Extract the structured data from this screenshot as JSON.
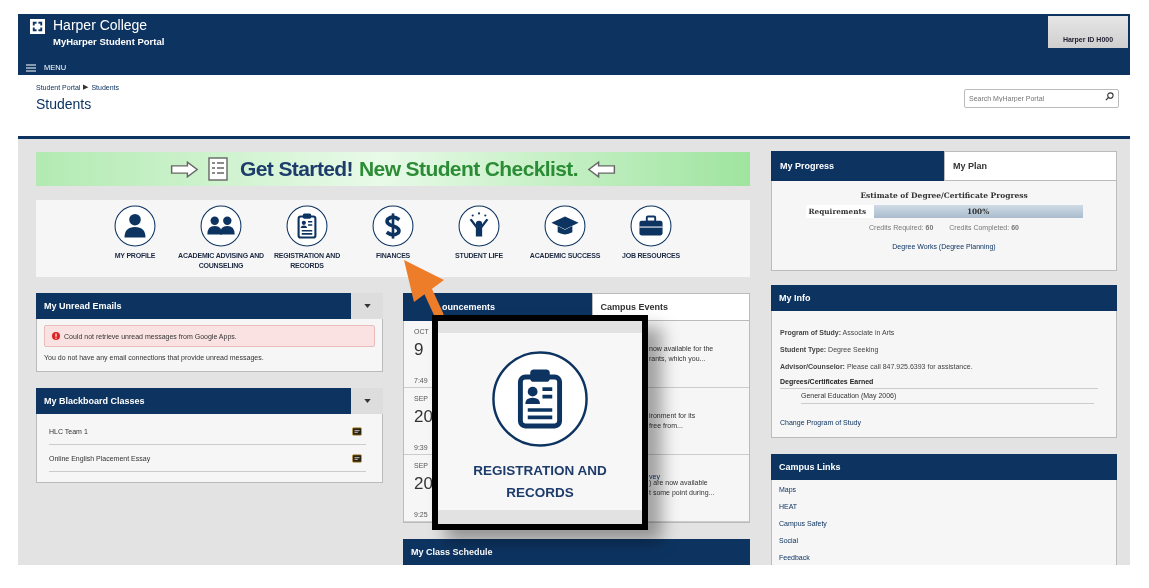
{
  "header": {
    "college": "Harper College",
    "portal": "MyHarper Student Portal",
    "menu": "MENU",
    "user_id": "Harper ID H000"
  },
  "breadcrumb": {
    "items": [
      "Student Portal",
      "Students"
    ],
    "separator": "▶"
  },
  "page_title": "Students",
  "search": {
    "placeholder": "Search MyHarper Portal"
  },
  "banner": {
    "lead": "Get Started!",
    "rest": "New Student Checklist."
  },
  "quick_links": [
    {
      "label": "MY PROFILE",
      "kind": "person"
    },
    {
      "label": "ACADEMIC ADVISING AND COUNSELING",
      "kind": "people"
    },
    {
      "label": "REGISTRATION AND RECORDS",
      "kind": "clipboard"
    },
    {
      "label": "FINANCES",
      "kind": "dollar"
    },
    {
      "label": "STUDENT LIFE",
      "kind": "cheer"
    },
    {
      "label": "ACADEMIC SUCCESS",
      "kind": "cap"
    },
    {
      "label": "JOB RESOURCES",
      "kind": "briefcase"
    }
  ],
  "emails": {
    "title": "My Unread Emails",
    "alert": "Could not retrieve unread messages from Google Apps.",
    "message": "You do not have any email connections that provide unread messages."
  },
  "blackboard": {
    "title": "My Blackboard Classes",
    "classes": [
      "HLC Team 1",
      "Online English Placement Essay"
    ]
  },
  "news": {
    "tabs": [
      {
        "label": "ouncements",
        "selected": true
      },
      {
        "label": "Campus Events",
        "selected": false
      }
    ],
    "items": [
      {
        "month": "OCT",
        "day": "9",
        "time": "7:49",
        "lines": [
          "now available for the",
          "rants, which you..."
        ]
      },
      {
        "month": "SEP",
        "day": "20",
        "time": "9:39",
        "lines": [
          "ironment for its",
          "free from..."
        ]
      },
      {
        "month": "SEP",
        "day": "20",
        "time": "9:25",
        "title": "vey",
        "lines": [
          ") are now available",
          "t some point during..."
        ]
      }
    ]
  },
  "class_schedule": {
    "title": "My Class Schedule"
  },
  "progress": {
    "tabs": [
      {
        "label": "My Progress",
        "selected": true
      },
      {
        "label": "My Plan",
        "selected": false
      }
    ],
    "heading": "Estimate of Degree/Certificate Progress",
    "bar_label": "Requirements",
    "level": 1,
    "reading": "100%",
    "credits": [
      "Credits Required: **60**",
      "Credits Completed: **60**"
    ],
    "link": "Degree Works (Degree Planning)"
  },
  "info": {
    "title": "My Info",
    "fields": [
      "**Program of Study:** Associate in Arts",
      "**Student Type:** Degree Seeking",
      "**Advisor/Counselor:** Please call 847.925.6393 for assistance."
    ],
    "degrees_heading": "Degrees/Certificates Earned",
    "degrees": [
      "General Education (May 2006)"
    ],
    "link": "Change Program of Study"
  },
  "campus_links": {
    "title": "Campus Links",
    "links": [
      "Maps",
      "HEAT",
      "Campus Safety",
      "Social",
      "Feedback"
    ]
  },
  "callout": {
    "label": "REGISTRATION AND RECORDS"
  }
}
